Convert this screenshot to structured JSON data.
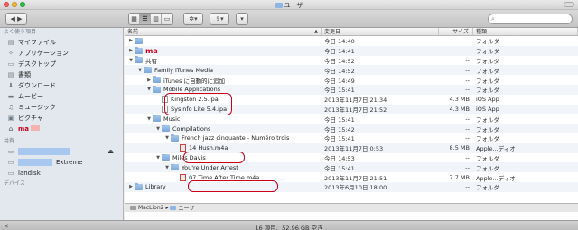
{
  "window": {
    "title": "ユーザ"
  },
  "toolbar": {
    "view_icons": [
      "icon-view-icon",
      "list-view-icon",
      "column-view-icon",
      "coverflow-view-icon"
    ],
    "action_label": "✲▾",
    "share_label": "⇪▾",
    "arrange_label": "▾"
  },
  "sidebar": {
    "favorites_header": "よく使う項目",
    "favorites": [
      {
        "label": "マイファイル",
        "icon": "all-files-icon"
      },
      {
        "label": "アプリケーション",
        "icon": "applications-icon"
      },
      {
        "label": "デスクトップ",
        "icon": "desktop-icon"
      },
      {
        "label": "書類",
        "icon": "documents-icon"
      },
      {
        "label": "ダウンロード",
        "icon": "downloads-icon"
      },
      {
        "label": "ムービー",
        "icon": "movies-icon"
      },
      {
        "label": "ミュージック",
        "icon": "music-icon"
      },
      {
        "label": "ピクチャ",
        "icon": "pictures-icon"
      },
      {
        "label": "ma",
        "icon": "home-icon"
      }
    ],
    "shared_header": "共有",
    "shared": [
      {
        "label": "",
        "icon": "network-icon",
        "eject": true
      },
      {
        "label": "Extreme",
        "icon": "airport-icon"
      },
      {
        "label": "landisk",
        "icon": "server-icon"
      }
    ],
    "devices_header": "デバイス"
  },
  "columns": {
    "name": "名前",
    "date": "変更日",
    "size": "サイズ",
    "kind": "種類"
  },
  "rows": [
    {
      "name": "",
      "date": "今日 14:40",
      "size": "--",
      "kind": "フォルダ"
    },
    {
      "name": "ma",
      "date": "今日 14:41",
      "size": "--",
      "kind": "フォルダ"
    },
    {
      "name": "共有",
      "date": "今日 14:52",
      "size": "--",
      "kind": "フォルダ"
    },
    {
      "name": "Family iTunes Media",
      "date": "今日 14:52",
      "size": "--",
      "kind": "フォルダ"
    },
    {
      "name": "iTunes に自動的に追加",
      "date": "今日 14:49",
      "size": "--",
      "kind": "フォルダ"
    },
    {
      "name": "Mobile Applications",
      "date": "今日 15:41",
      "size": "--",
      "kind": "フォルダ"
    },
    {
      "name": "Kingston 2.5.ipa",
      "date": "2013年11月7日 21:34",
      "size": "4.3 MB",
      "kind": "iOS App"
    },
    {
      "name": "SysInfo Lite 5.4.ipa",
      "date": "2013年11月7日 21:52",
      "size": "4.3 MB",
      "kind": "iOS App"
    },
    {
      "name": "Music",
      "date": "今日 15:41",
      "size": "--",
      "kind": "フォルダ"
    },
    {
      "name": "Compilations",
      "date": "今日 15:42",
      "size": "--",
      "kind": "フォルダ"
    },
    {
      "name": "French jazz cinquante - Numéro trois",
      "date": "今日 15:41",
      "size": "--",
      "kind": "フォルダ"
    },
    {
      "name": "14 Hush.m4a",
      "date": "2013年11月7日 0:53",
      "size": "8.5 MB",
      "kind": "Apple...ディオ"
    },
    {
      "name": "Miles Davis",
      "date": "今日 14:53",
      "size": "--",
      "kind": "フォルダ"
    },
    {
      "name": "You're Under Arrest",
      "date": "今日 15:41",
      "size": "--",
      "kind": "フォルダ"
    },
    {
      "name": "07 Time After Time.m4a",
      "date": "2013年11月7日 21:51",
      "size": "7.7 MB",
      "kind": "Apple...ディオ"
    },
    {
      "name": "Library",
      "date": "2013年6月10日 18:00",
      "size": "--",
      "kind": "フォルダ"
    }
  ],
  "pathbar": {
    "disk": "MacLion2",
    "folder": "ユーザ"
  },
  "status": {
    "text": "16 項目、52.96 GB 空き"
  },
  "colors": {
    "annotation": "#d0021b",
    "folder": "#7aa6d8",
    "sidebar_bg": "#e3e8ee"
  }
}
